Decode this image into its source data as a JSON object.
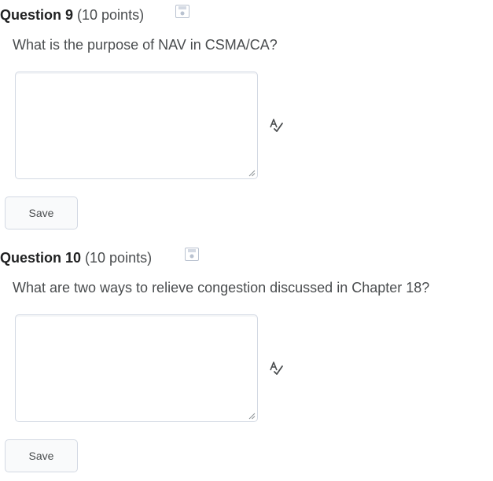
{
  "questions": [
    {
      "title": "Question 9",
      "points": "(10 points)",
      "prompt": "What is the purpose of NAV in CSMA/CA?",
      "answer_value": "",
      "save_label": "Save",
      "save_state_icon": "floppy-disk-icon",
      "spellcheck_icon": "spellcheck-icon"
    },
    {
      "title": "Question 10",
      "points": "(10 points)",
      "prompt": "What are two ways to relieve congestion discussed in Chapter 18?",
      "answer_value": "",
      "save_label": "Save",
      "save_state_icon": "floppy-disk-icon",
      "spellcheck_icon": "spellcheck-icon"
    }
  ],
  "colors": {
    "text": "#494c4e",
    "title": "#202122",
    "border": "#d3d9e3",
    "button_bg": "#f9fafb",
    "icon_gray": "#b9c2d0"
  }
}
